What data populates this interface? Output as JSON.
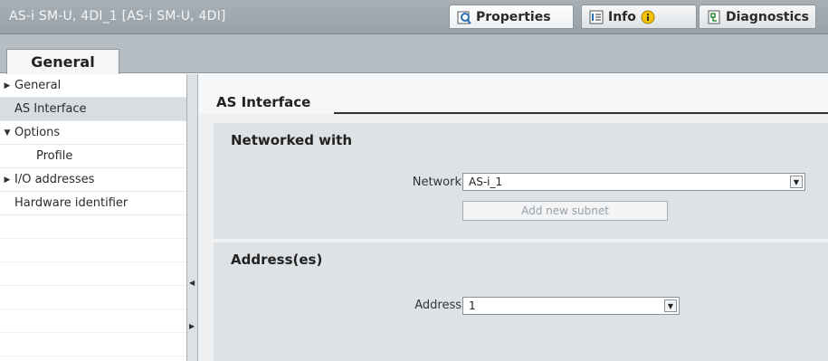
{
  "window": {
    "title": "AS-i SM-U, 4DI_1 [AS-i SM-U, 4DI]"
  },
  "top_tabs": [
    {
      "label": "Properties",
      "icon": "properties-icon",
      "active": true
    },
    {
      "label": "Info",
      "icon": "info-icon",
      "active": false
    },
    {
      "label": "Diagnostics",
      "icon": "diagnostics-icon",
      "active": false
    }
  ],
  "content_tab": {
    "label": "General"
  },
  "nav": {
    "items": [
      {
        "label": "General",
        "expander": "collapsed"
      },
      {
        "label": "AS Interface",
        "selected": true
      },
      {
        "label": "Options",
        "expander": "expanded"
      },
      {
        "label": "Profile"
      },
      {
        "label": "I/O addresses",
        "expander": "collapsed"
      },
      {
        "label": "Hardware identifier"
      }
    ]
  },
  "content": {
    "section_title": "AS Interface",
    "networked": {
      "title": "Networked with",
      "network_label": "Network",
      "network_value": "AS-i_1",
      "add_subnet_label": "Add new subnet"
    },
    "address": {
      "title": "Address(es)",
      "address_label": "Address",
      "address_value": "1"
    }
  },
  "colors": {
    "title_bar": "#a1a9af",
    "tab_strip": "#b7bec3",
    "panel": "#dfe2e5",
    "selection": "#d8dde1",
    "info_badge": "#f2c300"
  }
}
